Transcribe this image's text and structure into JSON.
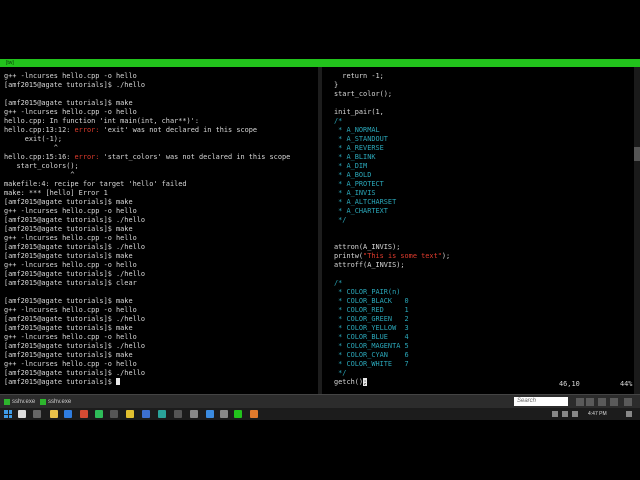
{
  "window": {
    "title": "[tw]"
  },
  "left_pane": {
    "lines": [
      {
        "t": "g++ -lncurses hello.cpp -o hello"
      },
      {
        "t": "[amf2015@agate tutorials]$ ./hello"
      },
      {
        "t": ""
      },
      {
        "t": "[amf2015@agate tutorials]$ make"
      },
      {
        "t": "g++ -lncurses hello.cpp -o hello"
      },
      {
        "t": "hello.cpp: In function 'int main(int, char**)':"
      },
      {
        "t": "hello.cpp:13:12: ",
        "e": "error:",
        "r": " 'exit' was not declared in this scope"
      },
      {
        "t": "     exit(-1);"
      },
      {
        "t": "            ^"
      },
      {
        "t": "hello.cpp:15:16: ",
        "e": "error:",
        "r": " 'start_colors' was not declared in this scope"
      },
      {
        "t": "   start_colors();"
      },
      {
        "t": "                ^"
      },
      {
        "t": "makefile:4: recipe for target 'hello' failed"
      },
      {
        "t": "make: *** [hello] Error 1"
      },
      {
        "t": "[amf2015@agate tutorials]$ make"
      },
      {
        "t": "g++ -lncurses hello.cpp -o hello"
      },
      {
        "t": "[amf2015@agate tutorials]$ ./hello"
      },
      {
        "t": "[amf2015@agate tutorials]$ make"
      },
      {
        "t": "g++ -lncurses hello.cpp -o hello"
      },
      {
        "t": "[amf2015@agate tutorials]$ ./hello"
      },
      {
        "t": "[amf2015@agate tutorials]$ make"
      },
      {
        "t": "g++ -lncurses hello.cpp -o hello"
      },
      {
        "t": "[amf2015@agate tutorials]$ ./hello"
      },
      {
        "t": "[amf2015@agate tutorials]$ clear"
      },
      {
        "t": ""
      },
      {
        "t": "[amf2015@agate tutorials]$ make"
      },
      {
        "t": "g++ -lncurses hello.cpp -o hello"
      },
      {
        "t": "[amf2015@agate tutorials]$ ./hello"
      },
      {
        "t": "[amf2015@agate tutorials]$ make"
      },
      {
        "t": "g++ -lncurses hello.cpp -o hello"
      },
      {
        "t": "[amf2015@agate tutorials]$ ./hello"
      },
      {
        "t": "[amf2015@agate tutorials]$ make"
      },
      {
        "t": "g++ -lncurses hello.cpp -o hello"
      },
      {
        "t": "[amf2015@agate tutorials]$ ./hello"
      },
      {
        "t": "[amf2015@agate tutorials]$ ",
        "cursor": true
      }
    ]
  },
  "right_pane": {
    "lines": [
      {
        "p": [
          {
            "s": "  return -1;"
          }
        ]
      },
      {
        "p": [
          {
            "s": "}"
          }
        ]
      },
      {
        "p": [
          {
            "s": "start_color();"
          }
        ]
      },
      {
        "p": [
          {
            "s": ""
          }
        ]
      },
      {
        "p": [
          {
            "s": "init_pair(1,"
          }
        ]
      },
      {
        "p": [
          {
            "s": "/*",
            "c": "cm"
          }
        ]
      },
      {
        "p": [
          {
            "s": " * A_NORMAL",
            "c": "cm"
          }
        ]
      },
      {
        "p": [
          {
            "s": " * A_STANDOUT",
            "c": "cm"
          }
        ]
      },
      {
        "p": [
          {
            "s": " * A_REVERSE",
            "c": "cm"
          }
        ]
      },
      {
        "p": [
          {
            "s": " * A_BLINK",
            "c": "cm"
          }
        ]
      },
      {
        "p": [
          {
            "s": " * A_DIM",
            "c": "cm"
          }
        ]
      },
      {
        "p": [
          {
            "s": " * A_BOLD",
            "c": "cm"
          }
        ]
      },
      {
        "p": [
          {
            "s": " * A_PROTECT",
            "c": "cm"
          }
        ]
      },
      {
        "p": [
          {
            "s": " * A_INVIS",
            "c": "cm"
          }
        ]
      },
      {
        "p": [
          {
            "s": " * A_ALTCHARSET",
            "c": "cm"
          }
        ]
      },
      {
        "p": [
          {
            "s": " * A_CHARTEXT",
            "c": "cm"
          }
        ]
      },
      {
        "p": [
          {
            "s": " */",
            "c": "cm"
          }
        ]
      },
      {
        "p": [
          {
            "s": ""
          }
        ]
      },
      {
        "p": [
          {
            "s": ""
          }
        ]
      },
      {
        "p": [
          {
            "s": "attron(A_INVIS);"
          }
        ]
      },
      {
        "p": [
          {
            "s": "printw("
          },
          {
            "s": "\"This is some text\"",
            "c": "str"
          },
          {
            "s": ");"
          }
        ]
      },
      {
        "p": [
          {
            "s": "attroff(A_INVIS);"
          }
        ]
      },
      {
        "p": [
          {
            "s": ""
          }
        ]
      },
      {
        "p": [
          {
            "s": "/*",
            "c": "cm"
          }
        ]
      },
      {
        "p": [
          {
            "s": " * COLOR_PAIR(n)",
            "c": "cm"
          }
        ]
      },
      {
        "p": [
          {
            "s": " * COLOR_BLACK   0",
            "c": "cm"
          }
        ]
      },
      {
        "p": [
          {
            "s": " * COLOR_RED     1",
            "c": "cm"
          }
        ]
      },
      {
        "p": [
          {
            "s": " * COLOR_GREEN   2",
            "c": "cm"
          }
        ]
      },
      {
        "p": [
          {
            "s": " * COLOR_YELLOW  3",
            "c": "cm"
          }
        ]
      },
      {
        "p": [
          {
            "s": " * COLOR_BLUE    4",
            "c": "cm"
          }
        ]
      },
      {
        "p": [
          {
            "s": " * COLOR_MAGENTA 5",
            "c": "cm"
          }
        ]
      },
      {
        "p": [
          {
            "s": " * COLOR_CYAN    6",
            "c": "cm"
          }
        ]
      },
      {
        "p": [
          {
            "s": " * COLOR_WHITE   7",
            "c": "cm"
          }
        ]
      },
      {
        "p": [
          {
            "s": " */",
            "c": "cm"
          }
        ]
      },
      {
        "p": [
          {
            "s": "getch()"
          },
          {
            "s": ";",
            "c": "cur"
          }
        ]
      }
    ],
    "status": {
      "position": "46,10",
      "percent": "44%"
    }
  },
  "tabs": [
    {
      "label": "sshv.exe"
    },
    {
      "label": "sshv.exe"
    }
  ],
  "search": {
    "placeholder": "Search"
  },
  "clock": {
    "time": "4:47 PM"
  },
  "colors": {
    "titlebar": "#22c31c",
    "error": "#e03b2d",
    "comment": "#2aa6b8",
    "text": "#d8d8d8"
  }
}
